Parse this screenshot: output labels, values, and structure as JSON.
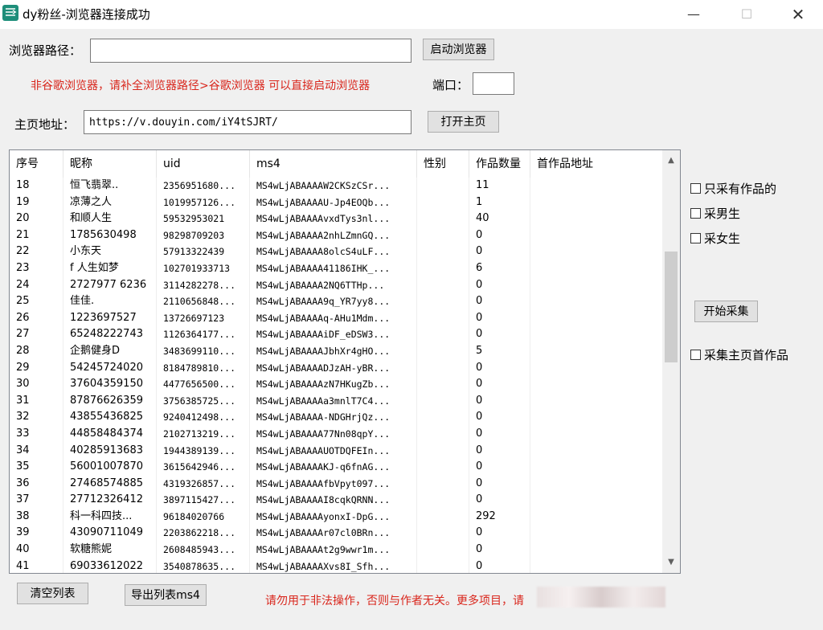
{
  "window": {
    "title": "dy粉丝-浏览器连接成功",
    "minimize": "—",
    "maximize": "☐",
    "close": "✕"
  },
  "browser": {
    "path_label": "浏览器路径：",
    "path_value": "",
    "launch_button": "启动浏览器",
    "hint": "非谷歌浏览器，请补全浏览器路径>谷歌浏览器 可以直接启动浏览器",
    "port_label": "端口：",
    "port_value": ""
  },
  "homepage": {
    "label": "主页地址：",
    "url": "https://v.douyin.com/iY4tSJRT/",
    "open_button": "打开主页"
  },
  "table": {
    "columns": [
      "序号",
      "昵称",
      "uid",
      "ms4",
      "性别",
      "作品数量",
      "首作品地址"
    ],
    "rows": [
      [
        "18",
        "恒飞翡翠..",
        "2356951680...",
        "MS4wLjABAAAAW2CKSzCSr...",
        "",
        "11",
        ""
      ],
      [
        "19",
        "凉薄之人",
        "1019957126...",
        "MS4wLjABAAAAU-Jp4EOQb...",
        "",
        "1",
        ""
      ],
      [
        "20",
        "和顺人生",
        "59532953021",
        "MS4wLjABAAAAvxdTys3nl...",
        "",
        "40",
        ""
      ],
      [
        "21",
        "1785630498",
        "98298709203",
        "MS4wLjABAAAA2nhLZmnGQ...",
        "",
        "0",
        ""
      ],
      [
        "22",
        "小东天",
        "57913322439",
        "MS4wLjABAAAA8olcS4uLF...",
        "",
        "0",
        ""
      ],
      [
        "23",
        "f 人生如梦",
        "102701933713",
        "MS4wLjABAAAA41186IHK_...",
        "",
        "6",
        ""
      ],
      [
        "24",
        "2727977 6236",
        "3114282278...",
        "MS4wLjABAAAA2NQ6TTHp...",
        "",
        "0",
        ""
      ],
      [
        "25",
        "佳佳.",
        "2110656848...",
        "MS4wLjABAAAA9q_YR7yy8...",
        "",
        "0",
        ""
      ],
      [
        "26",
        "1223697527",
        "13726697123",
        "MS4wLjABAAAAq-AHu1Mdm...",
        "",
        "0",
        ""
      ],
      [
        "27",
        "65248222743",
        "1126364177...",
        "MS4wLjABAAAAiDF_eDSW3...",
        "",
        "0",
        ""
      ],
      [
        "28",
        "企鹅健身D",
        "3483699110...",
        "MS4wLjABAAAAJbhXr4gHO...",
        "",
        "5",
        ""
      ],
      [
        "29",
        "54245724020",
        "8184789810...",
        "MS4wLjABAAAADJzAH-yBR...",
        "",
        "0",
        ""
      ],
      [
        "30",
        "37604359150",
        "4477656500...",
        "MS4wLjABAAAAzN7HKugZb...",
        "",
        "0",
        ""
      ],
      [
        "31",
        "87876626359",
        "3756385725...",
        "MS4wLjABAAAAa3mnlT7C4...",
        "",
        "0",
        ""
      ],
      [
        "32",
        "43855436825",
        "9240412498...",
        "MS4wLjABAAAA-NDGHrjQz...",
        "",
        "0",
        ""
      ],
      [
        "33",
        "44858484374",
        "2102713219...",
        "MS4wLjABAAAA77Nn08qpY...",
        "",
        "0",
        ""
      ],
      [
        "34",
        "40285913683",
        "1944389139...",
        "MS4wLjABAAAAUOTDQFEIn...",
        "",
        "0",
        ""
      ],
      [
        "35",
        "56001007870",
        "3615642946...",
        "MS4wLjABAAAAKJ-q6fnAG...",
        "",
        "0",
        ""
      ],
      [
        "36",
        "27468574885",
        "4319326857...",
        "MS4wLjABAAAAfbVpyt097...",
        "",
        "0",
        ""
      ],
      [
        "37",
        "27712326412",
        "3897115427...",
        "MS4wLjABAAAAI8cqkQRNN...",
        "",
        "0",
        ""
      ],
      [
        "38",
        "科一科四技...",
        "96184020766",
        "MS4wLjABAAAAyonxI-DpG...",
        "",
        "292",
        ""
      ],
      [
        "39",
        "43090711049",
        "2203862218...",
        "MS4wLjABAAAAr07cl0BRn...",
        "",
        "0",
        ""
      ],
      [
        "40",
        "软糖熊妮",
        "2608485943...",
        "MS4wLjABAAAAt2g9wwr1m...",
        "",
        "0",
        ""
      ],
      [
        "41",
        "69033612022",
        "3540878635...",
        "MS4wLjABAAAAXvs8I_Sfh...",
        "",
        "0",
        ""
      ]
    ]
  },
  "options": {
    "only_with_works": "只采有作品的",
    "collect_male": "采男生",
    "collect_female": "采女生",
    "start_button": "开始采集",
    "collect_homepage_first": "采集主页首作品"
  },
  "footer": {
    "clear_button": "清空列表",
    "export_button": "导出列表ms4",
    "notice": "请勿用于非法操作，否则与作者无关。更多项目，请"
  },
  "colors": {
    "warning_red": "#d9261c",
    "window_bg": "#f0f0f0",
    "app_icon": "#1e8e7a"
  }
}
